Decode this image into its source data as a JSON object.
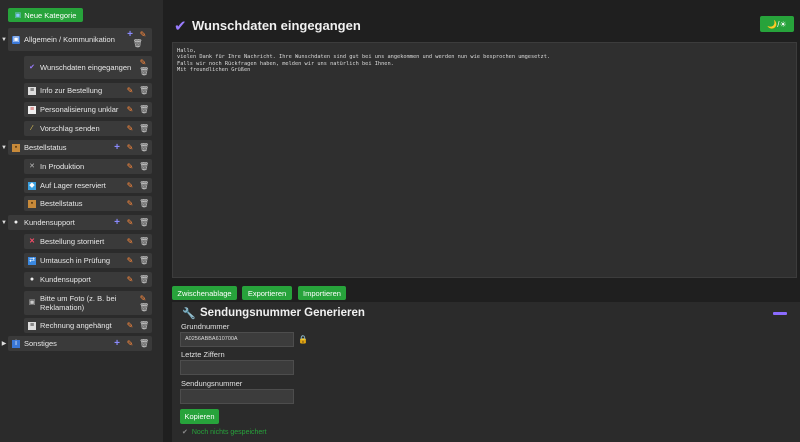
{
  "sidebar": {
    "new_category_label": "Neue Kategorie",
    "categories": [
      {
        "label": "Allgemein / Kommunikation",
        "icon": "speech-bubble-icon",
        "items": [
          {
            "label": "Wunschdaten eingegangen",
            "icon": "checkmark-icon"
          },
          {
            "label": "Info zur Bestellung",
            "icon": "document-icon"
          },
          {
            "label": "Personalisierung unklar",
            "icon": "notepad-icon"
          },
          {
            "label": "Vorschlag senden",
            "icon": "magic-wand-icon"
          }
        ]
      },
      {
        "label": "Bestellstatus",
        "icon": "package-icon",
        "items": [
          {
            "label": "In Produktion",
            "icon": "tools-icon"
          },
          {
            "label": "Auf Lager reserviert",
            "icon": "cube-icon"
          },
          {
            "label": "Bestellstatus",
            "icon": "package-icon"
          }
        ]
      },
      {
        "label": "Kundensupport",
        "icon": "chat-icon",
        "items": [
          {
            "label": "Bestellung storniert",
            "icon": "cross-icon"
          },
          {
            "label": "Umtausch in Prüfung",
            "icon": "exchange-icon"
          },
          {
            "label": "Kundensupport",
            "icon": "chat-icon"
          },
          {
            "label": "Bitte um Foto (z. B. bei Reklamation)",
            "icon": "camera-icon"
          },
          {
            "label": "Rechnung angehängt",
            "icon": "document-icon"
          }
        ]
      },
      {
        "label": "Sonstiges",
        "icon": "info-icon",
        "items": []
      }
    ]
  },
  "header": {
    "title": "Wunschdaten eingegangen",
    "theme_toggle": "🌙/☀"
  },
  "editor": {
    "text": "Hallo,\nvielen Dank für Ihre Nachricht. Ihre Wunschdaten sind gut bei uns angekommen und werden nun wie besprochen umgesetzt.\nFalls wir noch Rückfragen haben, melden wir uns natürlich bei Ihnen.\nMit freundlichen Grüßen"
  },
  "toolbar": {
    "clipboard": "Zwischenablage",
    "export": "Exportieren",
    "import": "Importieren"
  },
  "generator": {
    "title": "Sendungsnummer Generieren",
    "base_label": "Grundnummer",
    "base_value": "A0256ABBA610700A",
    "last_digits_label": "Letzte Ziffern",
    "last_digits_value": "",
    "tracking_label": "Sendungsnummer",
    "tracking_value": "",
    "copy_label": "Kopieren",
    "status": "Noch nichts gespeichert"
  },
  "colors": {
    "accent_green": "#27a33b",
    "accent_purple": "#9a7cff",
    "pencil_orange": "#ff8a3d"
  }
}
